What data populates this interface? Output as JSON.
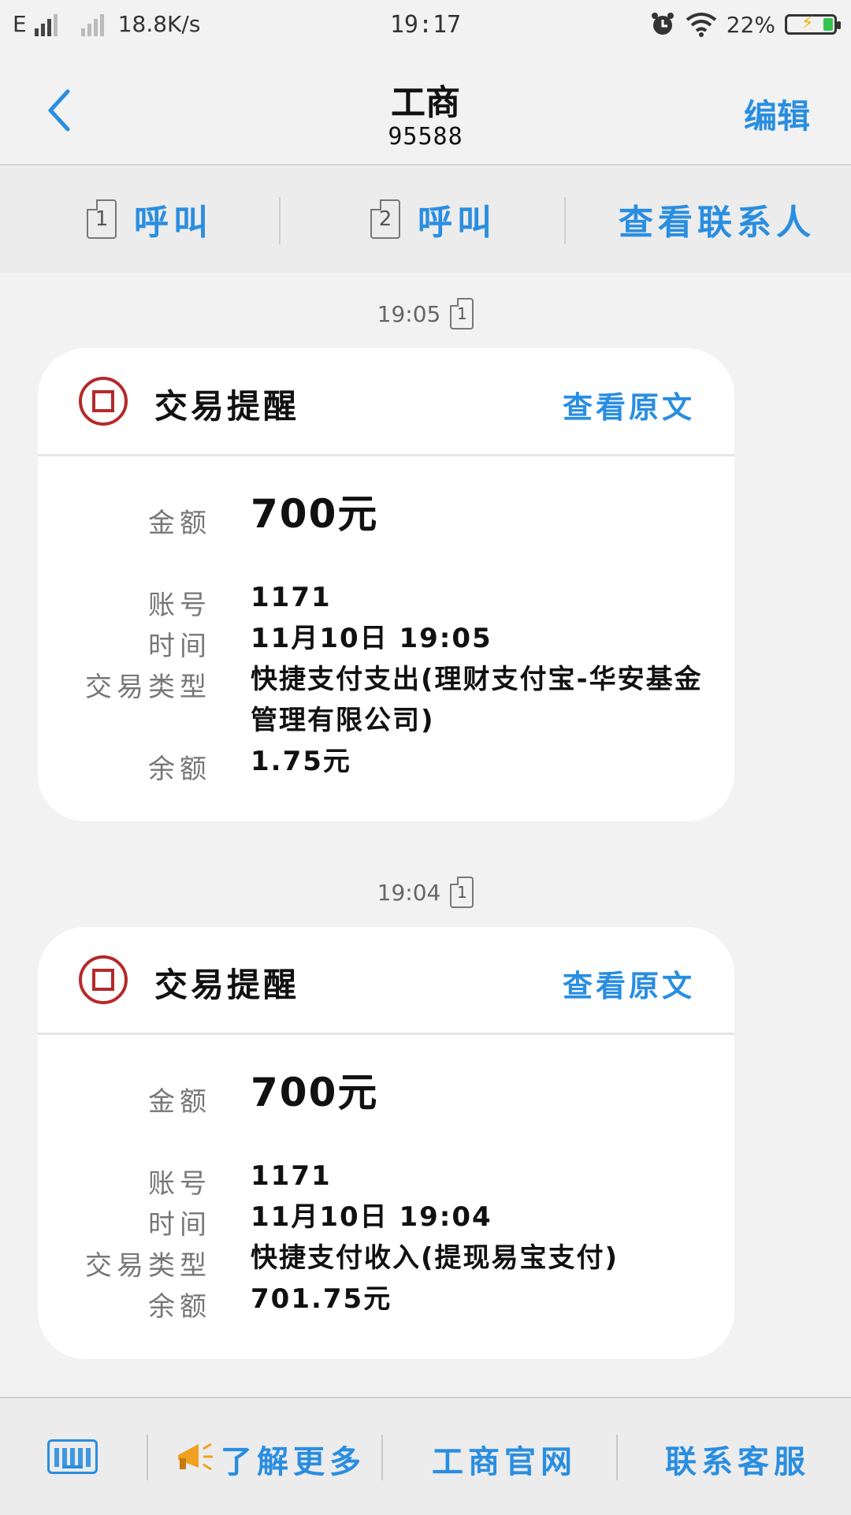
{
  "status_bar": {
    "network_type": "E",
    "speed": "18.8K/s",
    "time": "19:17",
    "battery": "22%"
  },
  "header": {
    "title": "工商",
    "number": "95588",
    "edit_label": "编辑"
  },
  "actions": {
    "call1_sim": "1",
    "call1_label": "呼叫",
    "call2_sim": "2",
    "call2_label": "呼叫",
    "view_contact_label": "查看联系人"
  },
  "messages": [
    {
      "time": "19:05",
      "sim": "1",
      "title": "交易提醒",
      "view_original": "查看原文",
      "fields": {
        "amount_label": "金额",
        "amount": "700元",
        "account_label": "账号",
        "account": "1171",
        "time_label": "时间",
        "time": "11月10日 19:05",
        "type_label": "交易类型",
        "type": "快捷支付支出(理财支付宝-华安基金管理有限公司)",
        "balance_label": "余额",
        "balance": "1.75元"
      }
    },
    {
      "time": "19:04",
      "sim": "1",
      "title": "交易提醒",
      "view_original": "查看原文",
      "fields": {
        "amount_label": "金额",
        "amount": "700元",
        "account_label": "账号",
        "account": "1171",
        "time_label": "时间",
        "time": "11月10日 19:04",
        "type_label": "交易类型",
        "type": "快捷支付收入(提现易宝支付)",
        "balance_label": "余额",
        "balance": "701.75元"
      }
    }
  ],
  "bottom_bar": {
    "learn_more": "了解更多",
    "official_site": "工商官网",
    "contact_service": "联系客服"
  },
  "colors": {
    "accent": "#2a8ee0",
    "brand_red": "#b42a2a",
    "background": "#f2f2f2"
  }
}
